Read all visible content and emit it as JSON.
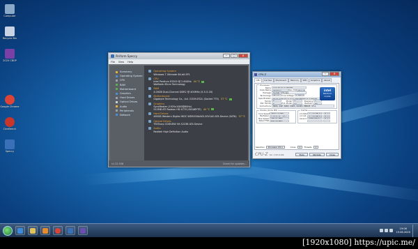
{
  "desktop_icons": [
    {
      "label": "Computer",
      "color": "#8aa8c8"
    },
    {
      "label": "Recycle Bin",
      "color": "#c7d3e2"
    },
    {
      "label": "2020 CBGP",
      "color": "#7b3fa8"
    },
    {
      "label": "Google Chrome",
      "color": "#db4437"
    },
    {
      "label": "CineBench",
      "color": "#c8362b"
    },
    {
      "label": "Speccy",
      "color": "#3a70b8"
    }
  ],
  "speccy": {
    "title": "Piriform Speccy",
    "menu": [
      "File",
      "View",
      "Help"
    ],
    "sidebar": [
      "Summary",
      "Operating System",
      "CPU",
      "RAM",
      "Motherboard",
      "Graphics",
      "Hard Drives",
      "Optical Drives",
      "Audio",
      "Peripherals",
      "Network"
    ],
    "sections": [
      {
        "title": "Operating System",
        "lines": [
          {
            "text": "Windows 7 Ultimate 64-bit SP1"
          }
        ]
      },
      {
        "title": "CPU",
        "lines": [
          {
            "text": "Intel Pentium E5300 @ 2.60GHz",
            "temp": "44 °C"
          },
          {
            "text": "Wolfdale 45nm Technology"
          }
        ]
      },
      {
        "title": "RAM",
        "lines": [
          {
            "text": "4.00GB Dual-Channel DDR2 @ 400MHz (5-5-5-18)"
          }
        ]
      },
      {
        "title": "Motherboard",
        "lines": [
          {
            "text": "Gigabyte Technology Co., Ltd. G31M-ES2L (Socket 775)",
            "temp": "37 °C"
          }
        ]
      },
      {
        "title": "Graphics",
        "lines": [
          {
            "text": "SyncMaster (1920x1080@60Hz)"
          },
          {
            "text": "512MB ATI Radeon HD 4770 (GIGABYTE)",
            "temp": "40 °C"
          }
        ]
      },
      {
        "title": "Hard Drives",
        "lines": [
          {
            "text": "465GB Western Digital WDC WD5000AAKS-00V1A0 ATA Device (SATA)",
            "temp": "37 °C"
          }
        ]
      },
      {
        "title": "Optical Drives",
        "lines": [
          {
            "text": "TSSTcorp CDDVDW SH-S223B ATA Device"
          }
        ]
      },
      {
        "title": "Audio",
        "lines": [
          {
            "text": "Realtek High Definition Audio"
          }
        ]
      }
    ],
    "version": "v1.22.536",
    "check_updates": "Check for updates..."
  },
  "cpuz": {
    "title": "CPU-Z",
    "tabs": [
      "CPU",
      "Caches",
      "Mainboard",
      "Memory",
      "SPD",
      "Graphics",
      "About"
    ],
    "processor_group": "Processor",
    "name_label": "Name",
    "name_value": "Intel Pentium E5300",
    "codename_label": "Code Name",
    "codename_value": "Wolfdale",
    "maxtdp_label": "Max TDP",
    "maxtdp_value": "65.0 W",
    "package_label": "Package",
    "package_value": "Socket 775 LGA",
    "technology_label": "Technology",
    "technology_value": "45 nm",
    "voltage_label": "Core Voltage",
    "voltage_value": "1.260 V",
    "spec_label": "Specification",
    "spec_value": "Pentium(R) Dual-Core CPU E5300 @ 2.60GHz",
    "family_label": "Family",
    "family_value": "6",
    "model_label": "Model",
    "model_value": "7",
    "stepping_label": "Stepping",
    "stepping_value": "A",
    "extfamily_label": "Ext. Family",
    "extfamily_value": "6",
    "extmodel_label": "Ext. Model",
    "extmodel_value": "17",
    "revision_label": "Revision",
    "revision_value": "R0",
    "instr_label": "Instructions",
    "instr_value": "MMX, SSE, SSE2, SSE3, SSSE3, EM64T, VT-x",
    "intel_logo_brand": "intel",
    "intel_logo_line1": "Pentium",
    "intel_logo_line2": "inside",
    "clocks_group": "Clocks (Core #0)",
    "clocks": [
      {
        "k": "Core Speed",
        "v": "2600.10 MHz"
      },
      {
        "k": "Multiplier",
        "v": "x 13.0 ( 6 - 13 )"
      },
      {
        "k": "Bus Speed",
        "v": "200.01 MHz"
      },
      {
        "k": "Rated FSB",
        "v": "800.03 MHz"
      }
    ],
    "cache_group": "Cache",
    "cache": [
      {
        "k": "L1 Data",
        "v": "2 x 32 KBytes",
        "w": "8-way"
      },
      {
        "k": "L1 Inst.",
        "v": "2 x 32 KBytes",
        "w": "8-way"
      },
      {
        "k": "Level 2",
        "v": "2048 KBytes",
        "w": "8-way"
      },
      {
        "k": "",
        "v": "",
        "w": ""
      }
    ],
    "selection_label": "Selection",
    "selection_value": "Processor #1",
    "cores_label": "Cores",
    "cores_value": "2",
    "threads_label": "Threads",
    "threads_value": "2",
    "brand": "CPU-Z",
    "version": "Ver. 1.93.0.x64",
    "tools_btn": "Tools",
    "validate_btn": "Validate",
    "close_btn": "Close"
  },
  "taskbar": {
    "apps": [
      {
        "name": "internet-explorer",
        "color": "#3d8ad8"
      },
      {
        "name": "file-explorer",
        "color": "#e3c15a"
      },
      {
        "name": "media-player",
        "color": "#e78a2c"
      },
      {
        "name": "chrome",
        "color": "#db4437"
      },
      {
        "name": "speccy",
        "color": "#3a70b8"
      },
      {
        "name": "cpu-z",
        "color": "#6a4fb0"
      }
    ],
    "time": "19:06",
    "date": "19.06.2020"
  },
  "watermark": "[1920x1080] https://upic.me/"
}
